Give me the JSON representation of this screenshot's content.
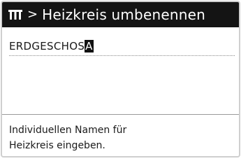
{
  "header": {
    "icon": "heating-circuit-icon",
    "separator": ">",
    "title": "Heizkreis umbenennen"
  },
  "input": {
    "value": "ERDGESCHOS",
    "cursor_char": "A"
  },
  "hint": {
    "line1": "Individuellen Namen für",
    "line2": "Heizkreis eingeben."
  }
}
